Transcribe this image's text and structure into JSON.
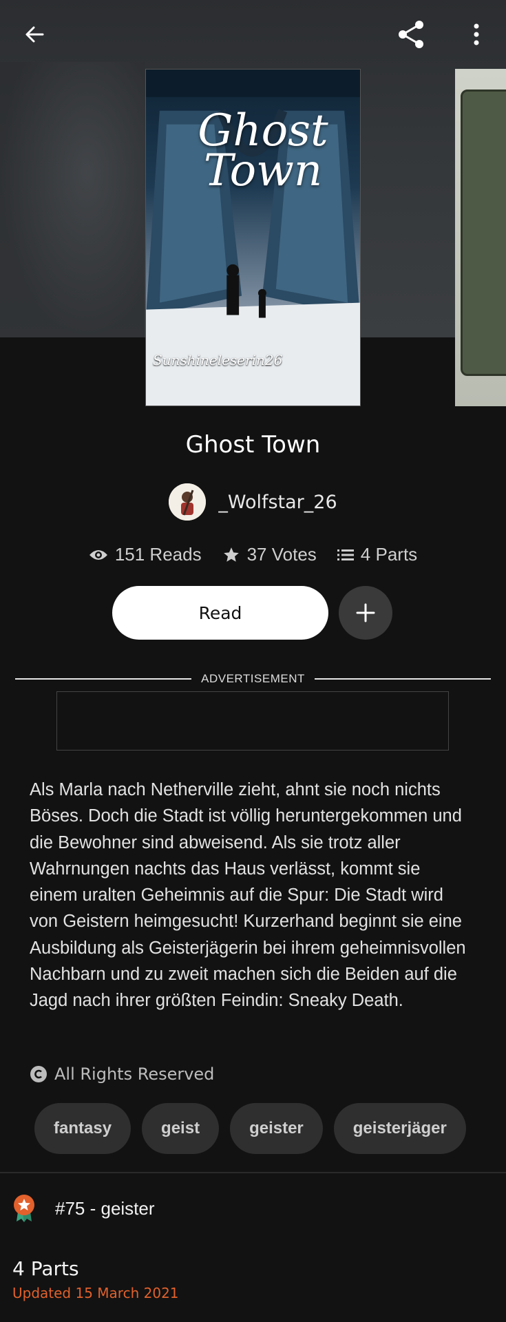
{
  "header": {
    "icons": {
      "back": "back-arrow-icon",
      "share": "share-icon",
      "more": "more-vertical-icon"
    }
  },
  "cover": {
    "title_art_line1": "Ghost",
    "title_art_line2": "Town",
    "author_art": "Sunshineleserin26"
  },
  "story": {
    "title": "Ghost Town",
    "author": "_Wolfstar_26",
    "reads": "151 Reads",
    "votes": "37 Votes",
    "parts": "4 Parts",
    "read_label": "Read",
    "add_icon": "plus-icon"
  },
  "ad": {
    "label": "ADVERTISEMENT"
  },
  "description": "Als Marla nach Netherville zieht, ahnt sie noch nichts Böses. Doch die Stadt ist völlig heruntergekommen und die Bewohner sind abweisend. Als sie trotz aller Wahrnungen nachts das Haus verlässt, kommt sie einem uralten Geheimnis auf die Spur: Die Stadt wird von Geistern heimgesucht! Kurzerhand beginnt sie eine Ausbildung als Geisterjägerin bei ihrem geheimnisvollen Nachbarn und zu zweit machen sich die Beiden auf die Jagd nach ihrer größten Feindin: Sneaky Death.",
  "rights": "All Rights Reserved",
  "tags": [
    "fantasy",
    "geist",
    "geister",
    "geisterjäger"
  ],
  "ranking": {
    "text": "#75 - geister"
  },
  "table_of_contents": {
    "title": "4 Parts",
    "updated": "Updated 15 March 2021"
  },
  "colors": {
    "accent": "#e2612c",
    "background": "#121212",
    "tag_bg": "#2f2f2f"
  }
}
